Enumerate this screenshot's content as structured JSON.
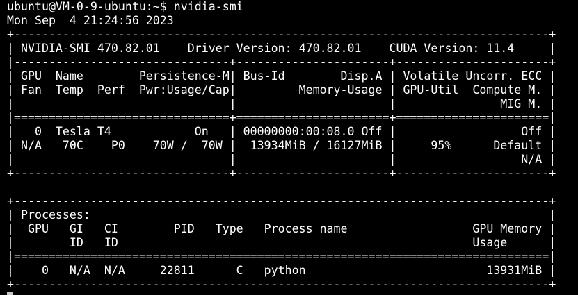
{
  "terminal": {
    "prompt": "ubuntu@VM-0-9-ubuntu:~$ nvidia-smi",
    "date": "Mon Sep  4 21:24:56 2023",
    "lines": [
      "+-----------------------------------------------------------------------------+",
      "| NVIDIA-SMI 470.82.01    Driver Version: 470.82.01    CUDA Version: 11.4     |",
      "|-------------------------------+----------------------+----------------------+",
      "| GPU  Name        Persistence-M| Bus-Id        Disp.A | Volatile Uncorr. ECC |",
      "| Fan  Temp  Perf  Pwr:Usage/Cap|         Memory-Usage | GPU-Util  Compute M. |",
      "|                               |                      |               MIG M. |",
      "|===============================+======================+======================|",
      "|   0  Tesla T4            On   | 00000000:00:08.0 Off |                  Off |",
      "| N/A   70C    P0    70W /  70W |  13934MiB / 16127MiB |     95%      Default |",
      "|                               |                      |                  N/A |",
      "+-------------------------------+----------------------+----------------------+",
      "",
      "+-----------------------------------------------------------------------------+",
      "| Processes:                                                                  |",
      "|  GPU   GI   CI        PID   Type   Process name                  GPU Memory |",
      "|        ID   ID                                                   Usage      |",
      "|=============================================================================|",
      "|    0   N/A  N/A     22811      C   python                          13931MiB |",
      "+-----------------------------------------------------------------------------+"
    ]
  }
}
